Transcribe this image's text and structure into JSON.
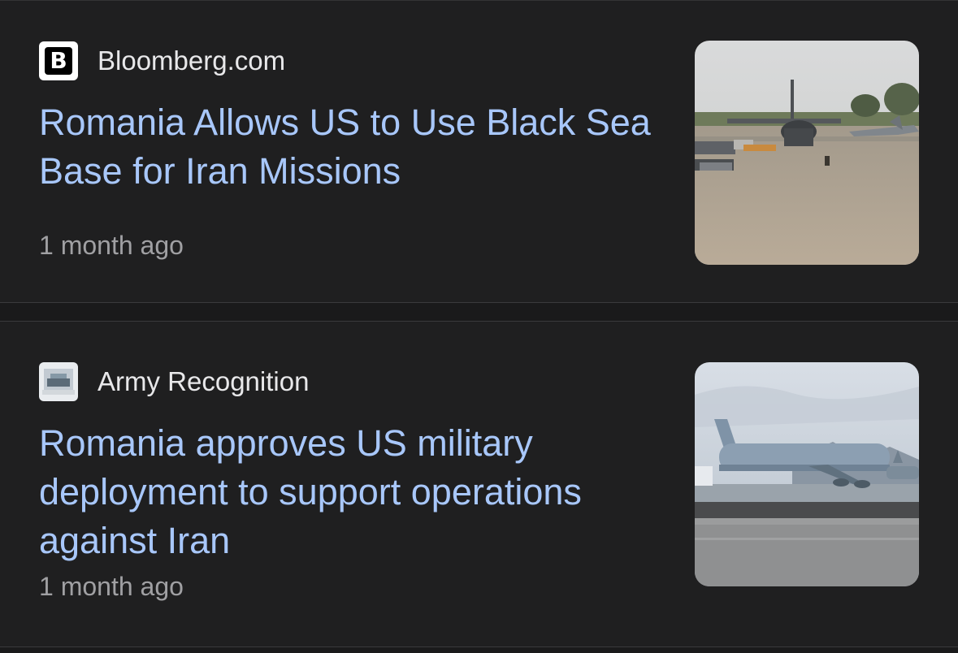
{
  "articles": [
    {
      "source": "Bloomberg.com",
      "favicon_icon": "bloomberg-b-icon",
      "headline": "Romania Allows US to Use Black Sea Base for Iran Missions",
      "timestamp": "1 month ago",
      "thumbnail": "airbase-aircraft-photo"
    },
    {
      "source": "Army Recognition",
      "favicon_icon": "army-recognition-icon",
      "headline": "Romania approves US military deployment to support operations against Iran",
      "timestamp": "1 month ago",
      "thumbnail": "tanker-aircraft-photo"
    }
  ],
  "colors": {
    "background": "#1f1f20",
    "headline": "#a8c7fa",
    "source": "#e8e8ea",
    "timestamp": "#a0a0a3"
  }
}
